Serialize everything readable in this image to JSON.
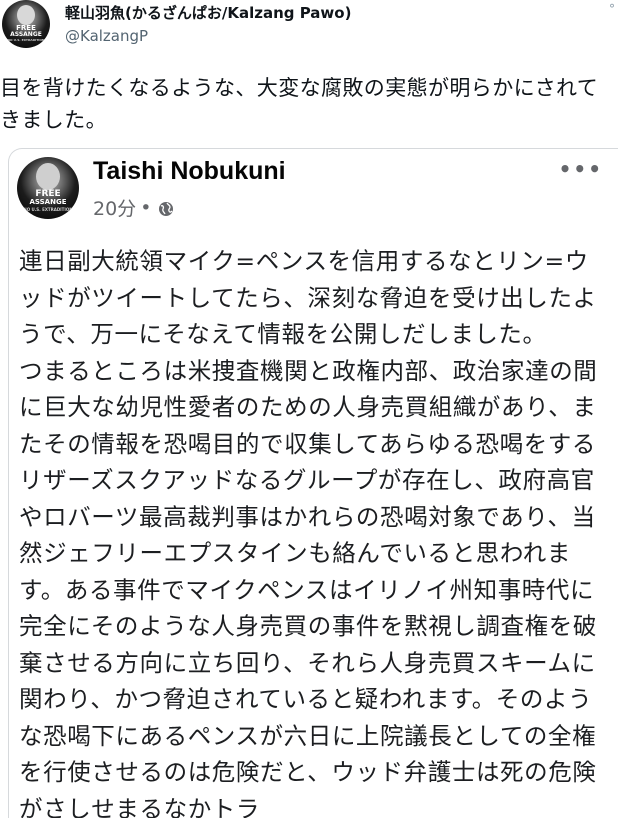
{
  "tweet": {
    "display_name": "軽山羽魚(かるざんぱお/Kalzang Pawo)",
    "handle": "@KalzangP",
    "text": "目を背けたくなるような、大変な腐敗の実態が明らかにされてきました。",
    "avatar_text": [
      "FREE",
      "ASSANGE",
      "NO U.S. EXTRADITION"
    ]
  },
  "embedded_post": {
    "author": "Taishi Nobukuni",
    "time": "20分",
    "dot": "•",
    "audience_icon": "globe-icon",
    "more_icon": "more-horizontal-icon",
    "avatar_text": [
      "FREE",
      "ASSANGE",
      "NO U.S. EXTRADITION"
    ],
    "body": [
      "連日副大統領マイク=ペンスを信用するなとリン=ウッドがツイートしてたら、深刻な脅迫を受け出したようで、万一にそなえて情報を公開しだしました。",
      "つまるところは米捜査機関と政権内部、政治家達の間に巨大な幼児性愛者のための人身売買組織があり、またその情報を恐喝目的で収集してあらゆる恐喝をするリザーズスクアッドなるグループが存在し、政府高官やロバーツ最高裁判事はかれらの恐喝対象であり、当然ジェフリーエプスタインも絡んでいると思われます。ある事件でマイクペンスはイリノイ州知事時代に完全にそのような人身売買の事件を黙視し調査権を破棄させる方向に立ち回り、それら人身売買スキームに関わり、かつ脅迫されていると疑われます。そのような恐喝下にあるペンスが六日に上院議長としての全権を行使させるのは危険だと、ウッド弁護士は死の危険がさしせまるなかトラ"
    ]
  },
  "colors": {
    "text_primary": "#0f1419",
    "text_secondary": "#536471",
    "fb_text": "#1c1e21",
    "fb_meta": "#65676b"
  }
}
